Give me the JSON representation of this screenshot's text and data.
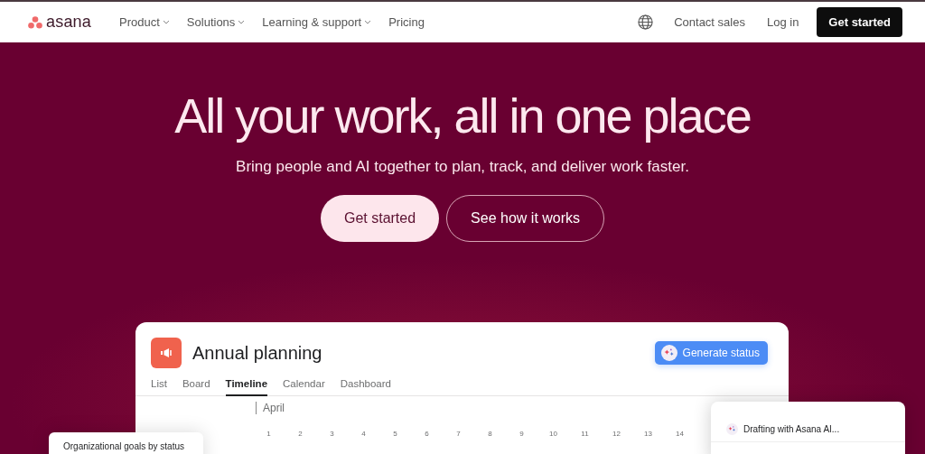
{
  "nav": {
    "logo": "asana",
    "menu": [
      {
        "label": "Product",
        "dropdown": true
      },
      {
        "label": "Solutions",
        "dropdown": true
      },
      {
        "label": "Learning & support",
        "dropdown": true
      },
      {
        "label": "Pricing",
        "dropdown": false
      }
    ],
    "contact": "Contact sales",
    "login": "Log in",
    "cta": "Get started"
  },
  "hero": {
    "title": "All your work, all in one place",
    "subtitle": "Bring people and AI together to plan, track, and deliver work faster.",
    "primary": "Get started",
    "secondary": "See how it works"
  },
  "project": {
    "title": "Annual planning",
    "action": "Generate status",
    "tabs": [
      {
        "label": "List",
        "selected": false
      },
      {
        "label": "Board",
        "selected": false
      },
      {
        "label": "Timeline",
        "selected": true
      },
      {
        "label": "Calendar",
        "selected": false
      },
      {
        "label": "Dashboard",
        "selected": false
      }
    ],
    "month": "April",
    "days": [
      "1",
      "2",
      "3",
      "4",
      "5",
      "6",
      "7",
      "8",
      "9",
      "10",
      "11",
      "12",
      "13",
      "14"
    ]
  },
  "goals_card": {
    "title": "Organizational goals by status"
  },
  "ai_card": {
    "text": "Drafting with Asana AI..."
  }
}
